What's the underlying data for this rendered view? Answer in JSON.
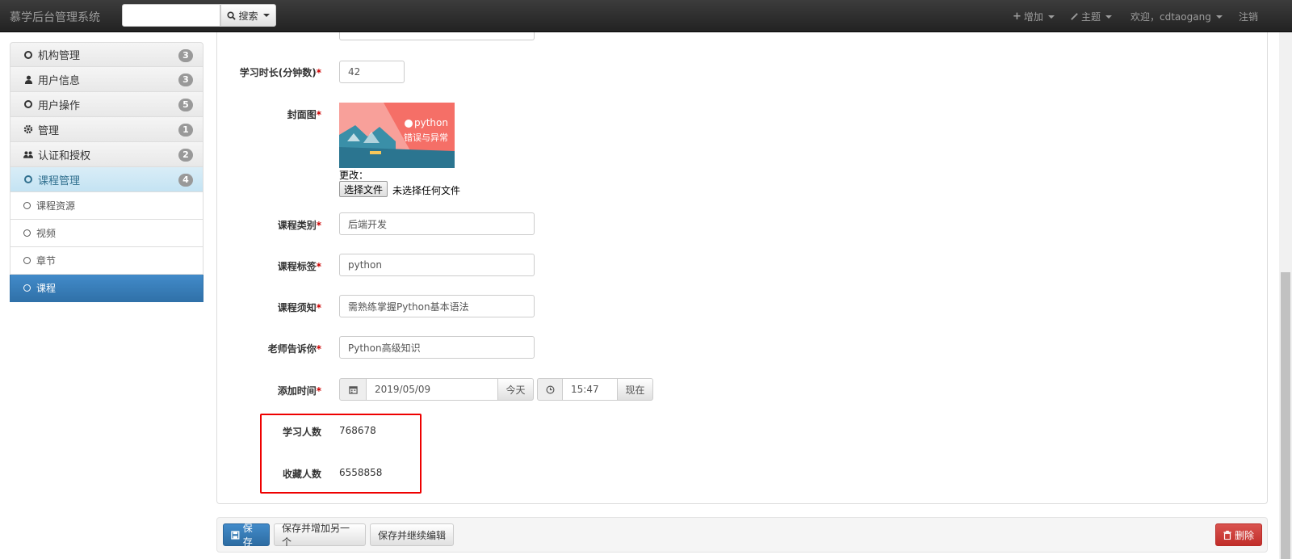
{
  "navbar": {
    "brand": "慕学后台管理系统",
    "search_value": "",
    "search_label": "搜索",
    "add_label": "增加",
    "theme_label": "主题",
    "welcome_label": "欢迎，cdtaogang",
    "logout_label": "注销"
  },
  "sidebar": {
    "items": [
      {
        "label": "机构管理",
        "badge": "3",
        "icon": "circle-icon"
      },
      {
        "label": "用户信息",
        "badge": "3",
        "icon": "user-icon"
      },
      {
        "label": "用户操作",
        "badge": "5",
        "icon": "circle-icon"
      },
      {
        "label": "管理",
        "badge": "1",
        "icon": "gear-icon"
      },
      {
        "label": "认证和授权",
        "badge": "2",
        "icon": "users-icon"
      },
      {
        "label": "课程管理",
        "badge": "4",
        "icon": "circle-icon"
      }
    ],
    "subitems": [
      {
        "label": "课程资源"
      },
      {
        "label": "视频"
      },
      {
        "label": "章节"
      },
      {
        "label": "课程"
      }
    ]
  },
  "form": {
    "duration_label": "学习时长(分钟数)",
    "duration_value": "42",
    "cover_label": "封面图",
    "cover_title": "python",
    "cover_subtitle": "错误与异常",
    "change_label": "更改：",
    "file_button": "选择文件",
    "file_status": "未选择任何文件",
    "category_label": "课程类别",
    "category_value": "后端开发",
    "tag_label": "课程标签",
    "tag_value": "python",
    "notice_label": "课程须知",
    "notice_value": "需熟练掌握Python基本语法",
    "teacher_label": "老师告诉你",
    "teacher_value": "Python高级知识",
    "add_time_label": "添加时间",
    "date_value": "2019/05/09",
    "today_button": "今天",
    "time_value": "15:47",
    "now_button": "现在",
    "students_label": "学习人数",
    "students_value": "768678",
    "favorites_label": "收藏人数",
    "favorites_value": "6558858",
    "required_mark": "*"
  },
  "actions": {
    "save": "保存",
    "save_add": "保存并增加另一个",
    "save_continue": "保存并继续编辑",
    "delete": "删除"
  },
  "colors": {
    "primary": "#428bca",
    "danger": "#d9534f",
    "highlight": "#ee0000"
  }
}
